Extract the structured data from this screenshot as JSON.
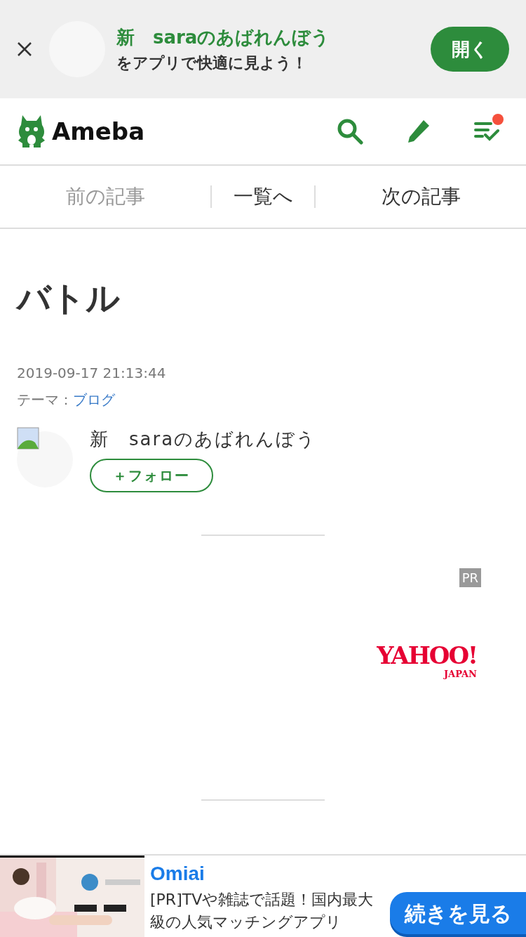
{
  "app_banner": {
    "blog_name": "新　saraのあばれんぼう",
    "message": "をアプリで快適に見よう！",
    "open_button": "開く"
  },
  "header": {
    "logo": "Ameba",
    "notification": true
  },
  "article_nav": [
    {
      "label": "前の記事",
      "disabled": true
    },
    {
      "label": "一覧へ",
      "disabled": false
    },
    {
      "label": "次の記事",
      "disabled": false
    }
  ],
  "article": {
    "title": "バトル",
    "date": "2019-09-17 21:13:44",
    "theme_label": "テーマ：",
    "theme": "ブログ",
    "author": "新　saraのあばれんぼう",
    "follow_button": "＋フォロー"
  },
  "ad": {
    "pr_badge": "PR",
    "logo_main": "YAHOO!",
    "logo_sub": "JAPAN"
  },
  "bottom_ad": {
    "title": "Omiai",
    "text": "[PR]TVや雑誌で話題！国内最大級の人気マッチングアプリ",
    "button": "続きを見る"
  }
}
